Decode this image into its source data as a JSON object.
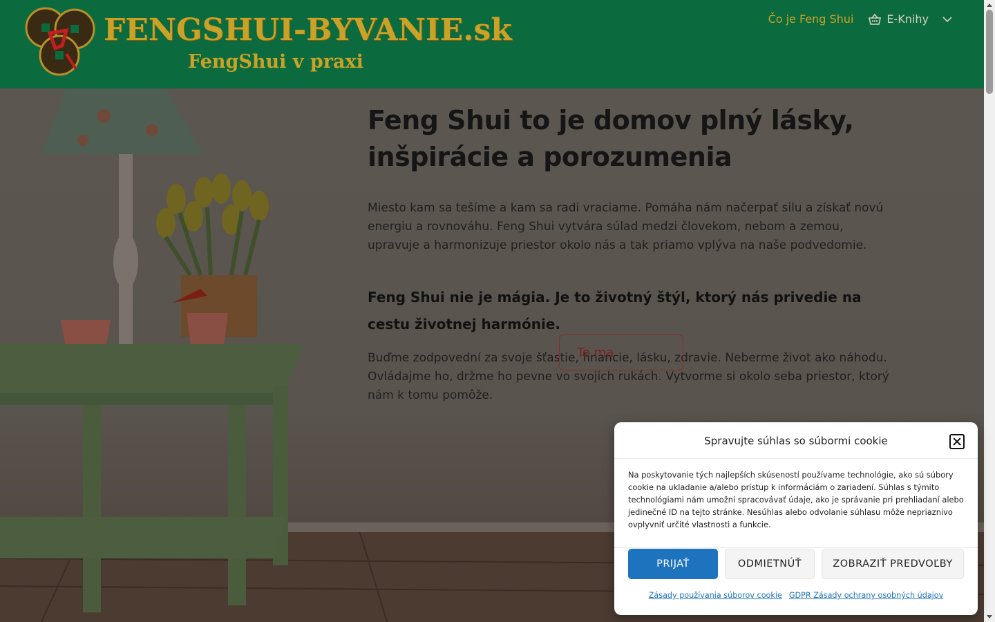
{
  "header": {
    "brand_title": "FENGSHUI-BYVANIE.sk",
    "brand_subtitle": "FengShui v praxi",
    "nav": {
      "about_label": "Čo je Feng Shui",
      "ebooks_label": "E-Knihy"
    }
  },
  "hero": {
    "title": "Feng Shui to je domov plný lásky, inšpirácie a porozumenia",
    "text1": "Miesto kam sa tešíme a kam sa radi vraciame. Pomáha nám načerpať silu a získať novú energiu a rovnováhu. Feng Shui vytvára súlad medzi človekom, nebom a zemou, upravuje a harmonizuje priestor okolo nás a tak priamo vplýva na naše podvedomie.",
    "subtitle": "Feng Shui nie je mágia. Je to životný štýl, ktorý nás privedie na cestu životnej harmónie.",
    "text2": "Buďme zodpovední za svoje šťastie, financie, lásku, zdravie. Neberme život ako náhodu. Ovládajme ho, držme ho pevne vo svojich rukách. Vytvorme si okolo seba priestor, ktorý nám k tomu pomôže.",
    "cta_label": "To ma"
  },
  "cookie": {
    "title": "Spravujte súhlas so súbormi cookie",
    "body": "Na poskytovanie tých najlepších skúseností používame technológie, ako sú súbory cookie na ukladanie a/alebo prístup k informáciám o zariadení. Súhlas s týmito technológiami nám umožní spracovávať údaje, ako je správanie pri prehliadaní alebo jedinečné ID na tejto stránke. Nesúhlas alebo odvolanie súhlasu môže nepriaznivo ovplyvniť určité vlastnosti a funkcie.",
    "accept_label": "PRIJAŤ",
    "deny_label": "ODMIETNÚŤ",
    "prefs_label": "ZOBRAZIŤ PREDVOĽBY",
    "link_cookie_policy": "Zásady používania súborov cookie",
    "link_gdpr": "GDPR Zásady ochrany osobných údajov"
  },
  "colors": {
    "header_bg": "#0b6b3f",
    "brand_gold": "#c9a227",
    "accept_blue": "#1e73be",
    "cta_red": "#8a2a2a"
  }
}
